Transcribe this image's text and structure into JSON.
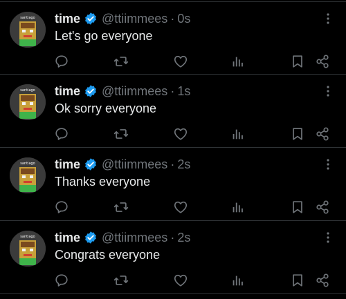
{
  "tweets": [
    {
      "author_name": "time",
      "handle": "@ttiimmees",
      "separator": "·",
      "time": "0s",
      "text": "Let's go everyone",
      "avatar_label": "santiago"
    },
    {
      "author_name": "time",
      "handle": "@ttiimmees",
      "separator": "·",
      "time": "1s",
      "text": "Ok sorry everyone",
      "avatar_label": "santiago"
    },
    {
      "author_name": "time",
      "handle": "@ttiimmees",
      "separator": "·",
      "time": "2s",
      "text": "Thanks everyone",
      "avatar_label": "santiago"
    },
    {
      "author_name": "time",
      "handle": "@ttiimmees",
      "separator": "·",
      "time": "2s",
      "text": "Congrats everyone",
      "avatar_label": "santiago"
    }
  ],
  "icons": {
    "verified": "verified-badge-icon",
    "more": "more-options-icon",
    "reply": "reply-icon",
    "retweet": "retweet-icon",
    "like": "like-icon",
    "views": "views-icon",
    "bookmark": "bookmark-icon",
    "share": "share-icon"
  },
  "colors": {
    "background": "#000000",
    "text_primary": "#e7e9ea",
    "text_secondary": "#71767b",
    "verified_blue": "#1d9bf0",
    "divider": "#2f3336"
  }
}
